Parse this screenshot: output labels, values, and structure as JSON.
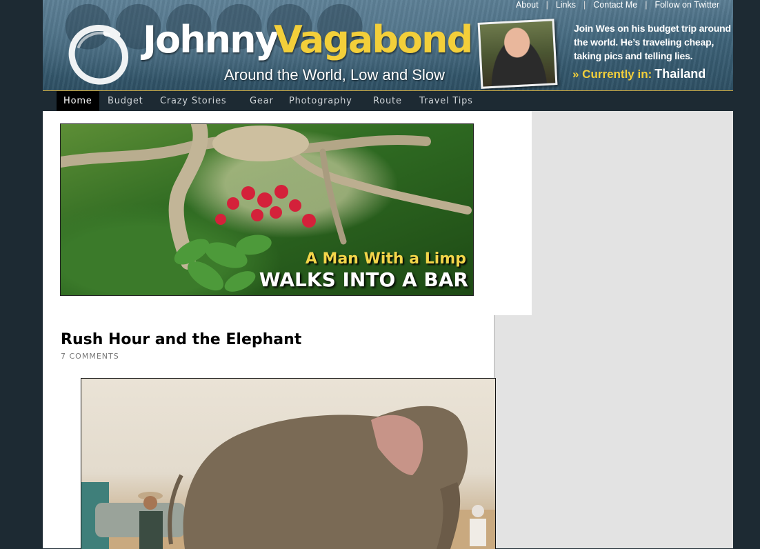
{
  "header": {
    "logo_first": "Johnny",
    "logo_second": "Vagabond",
    "tagline": "Around the World, Low and Slow",
    "blurb": "Join Wes on his budget trip around the world. He’s traveling cheap, taking pics and telling lies.",
    "currently_label": "» Currently in:",
    "currently_location": "Thailand",
    "top_links": [
      "About",
      "Links",
      "Contact Me",
      "Follow on Twitter"
    ]
  },
  "nav": {
    "items": [
      "Home",
      "Budget",
      "Crazy Stories",
      "Gear",
      "Photography",
      "Route",
      "Travel Tips"
    ],
    "active": "Home"
  },
  "featured": {
    "line1": "A Man With a Limp",
    "line2": "WALKS INTO A BAR"
  },
  "post": {
    "title": "Rush Hour and the Elephant",
    "comments": "7 COMMENTS"
  },
  "colors": {
    "accent_yellow": "#f3cf3a",
    "page_background": "#1d2a33",
    "sidebar": "#e3e3e3"
  }
}
